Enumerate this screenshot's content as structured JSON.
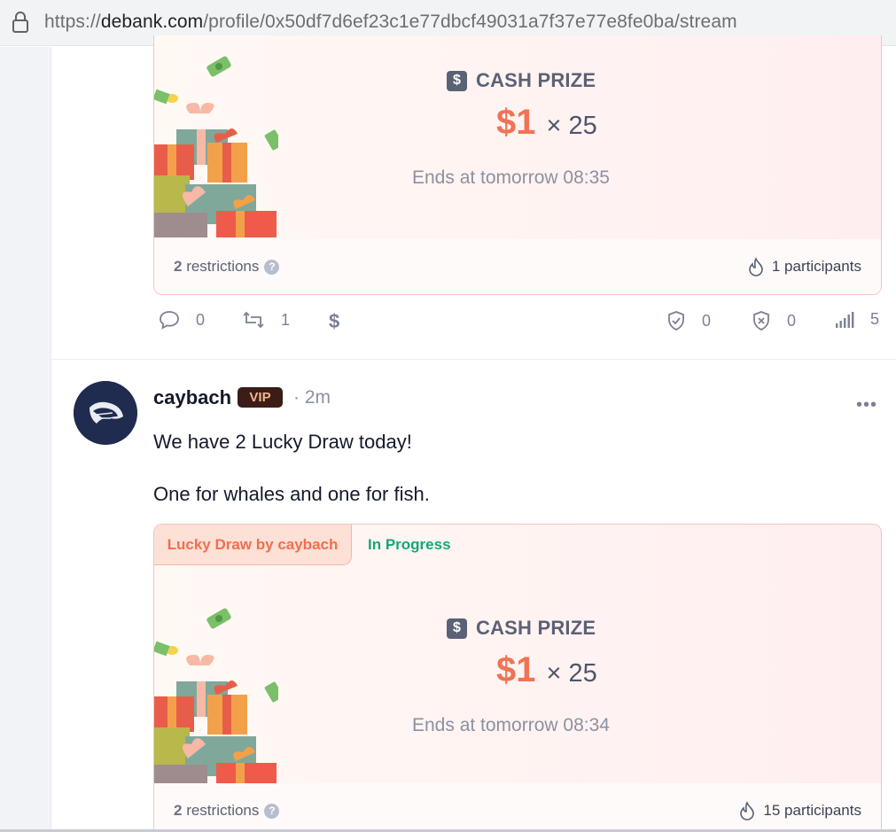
{
  "browser": {
    "url_prefix": "https://",
    "url_host": "debank.com",
    "url_path": "/profile/0x50df7d6ef23c1e77dbcf49031a7f37e77e8fe0ba/stream"
  },
  "post1": {
    "draw": {
      "prize_label": "CASH PRIZE",
      "amount": "$1",
      "multiplier": "× 25",
      "ends": "Ends at tomorrow 08:35",
      "restrictions_count": "2",
      "restrictions_label": " restrictions",
      "participants": "1 participants"
    },
    "actions": {
      "comments": "0",
      "reposts": "1",
      "trust": "0",
      "spam": "0",
      "views": "5"
    }
  },
  "post2": {
    "username": "caybach",
    "badge": "VIP",
    "time": "· 2m",
    "line1": "We have 2 Lucky Draw today!",
    "line2": "One for whales and one for fish.",
    "draw": {
      "owner_tab": "Lucky Draw by caybach",
      "status": "In Progress",
      "prize_label": "CASH PRIZE",
      "amount": "$1",
      "multiplier": "× 25",
      "ends": "Ends at tomorrow 08:34",
      "restrictions_count": "2",
      "restrictions_label": " restrictions",
      "participants": "15 participants"
    }
  },
  "colors": {
    "accent": "#f07355",
    "status_green": "#12a87a",
    "vip_bg": "#3b1d17"
  }
}
